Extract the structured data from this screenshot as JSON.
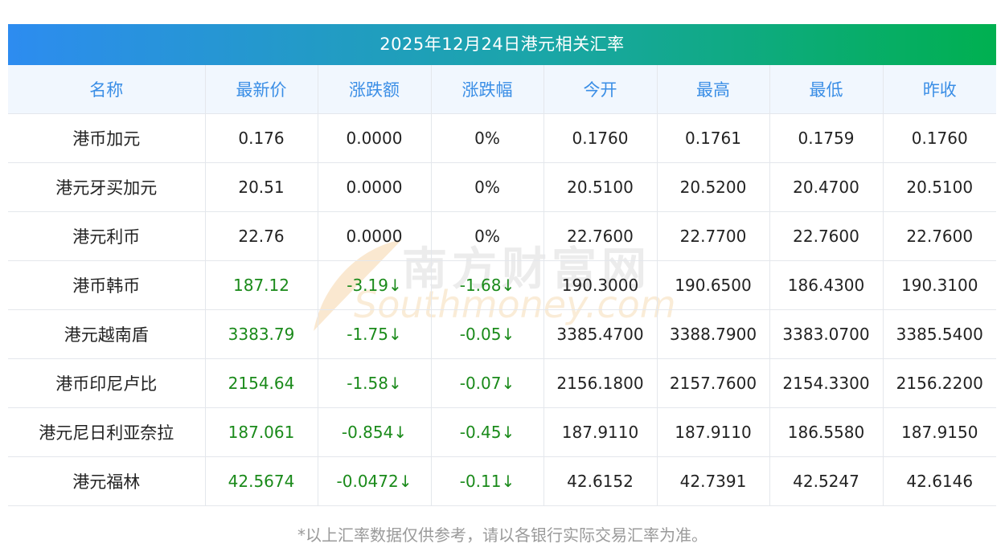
{
  "title": "2025年12月24日港元相关汇率",
  "columns": [
    "名称",
    "最新价",
    "涨跌额",
    "涨跌幅",
    "今开",
    "最高",
    "最低",
    "昨收"
  ],
  "rows": [
    {
      "name": "港币加元",
      "latest": "0.176",
      "change": "0.0000",
      "pct": "0%",
      "open": "0.1760",
      "high": "0.1761",
      "low": "0.1759",
      "prev": "0.1760",
      "trend": "flat"
    },
    {
      "name": "港元牙买加元",
      "latest": "20.51",
      "change": "0.0000",
      "pct": "0%",
      "open": "20.5100",
      "high": "20.5200",
      "low": "20.4700",
      "prev": "20.5100",
      "trend": "flat"
    },
    {
      "name": "港元利币",
      "latest": "22.76",
      "change": "0.0000",
      "pct": "0%",
      "open": "22.7600",
      "high": "22.7700",
      "low": "22.7600",
      "prev": "22.7600",
      "trend": "flat"
    },
    {
      "name": "港币韩币",
      "latest": "187.12",
      "change": "-3.19↓",
      "pct": "-1.68↓",
      "open": "190.3000",
      "high": "190.6500",
      "low": "186.4300",
      "prev": "190.3100",
      "trend": "down"
    },
    {
      "name": "港元越南盾",
      "latest": "3383.79",
      "change": "-1.75↓",
      "pct": "-0.05↓",
      "open": "3385.4700",
      "high": "3388.7900",
      "low": "3383.0700",
      "prev": "3385.5400",
      "trend": "down"
    },
    {
      "name": "港币印尼卢比",
      "latest": "2154.64",
      "change": "-1.58↓",
      "pct": "-0.07↓",
      "open": "2156.1800",
      "high": "2157.7600",
      "low": "2154.3300",
      "prev": "2156.2200",
      "trend": "down"
    },
    {
      "name": "港元尼日利亚奈拉",
      "latest": "187.061",
      "change": "-0.854↓",
      "pct": "-0.45↓",
      "open": "187.9110",
      "high": "187.9110",
      "low": "186.5580",
      "prev": "187.9150",
      "trend": "down"
    },
    {
      "name": "港元福林",
      "latest": "42.5674",
      "change": "-0.0472↓",
      "pct": "-0.11↓",
      "open": "42.6152",
      "high": "42.7391",
      "low": "42.5247",
      "prev": "42.6146",
      "trend": "down"
    }
  ],
  "watermark": {
    "cn": "南方财富网",
    "en": "Southmoney.com"
  },
  "footnote": "*以上汇率数据仅供参考，请以各银行实际交易汇率为准。",
  "colors": {
    "header_text": "#3a8ee6",
    "down": "#1a8a1a",
    "title_gradient_start": "#2d8cf0",
    "title_gradient_end": "#00b050"
  }
}
